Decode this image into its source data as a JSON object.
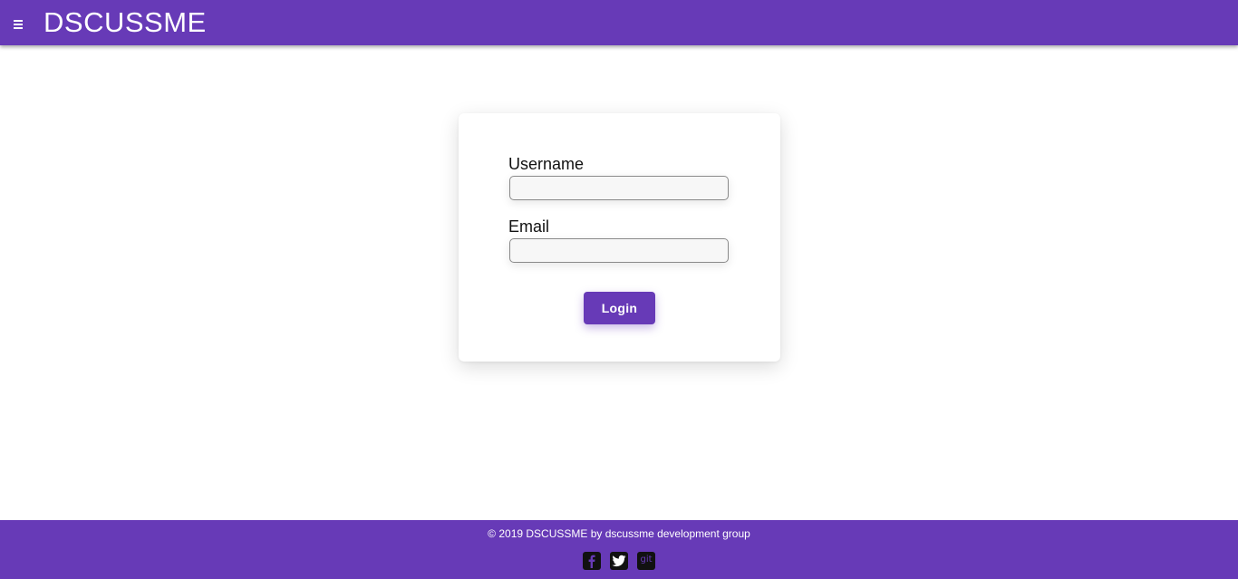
{
  "header": {
    "menu_icon": "hamburger-menu-icon",
    "brand": "DSCUSSME",
    "color": "#673ab7"
  },
  "login_form": {
    "username_label": "Username",
    "username_value": "",
    "username_placeholder": "",
    "email_label": "Email",
    "email_value": "",
    "email_placeholder": "",
    "login_button": "Login"
  },
  "footer": {
    "copyright": "© 2019 DSCUSSME by dscussme development group",
    "social": [
      {
        "name": "facebook-icon",
        "label": ""
      },
      {
        "name": "twitter-icon",
        "label": ""
      },
      {
        "name": "git-icon",
        "label": "git"
      }
    ]
  }
}
